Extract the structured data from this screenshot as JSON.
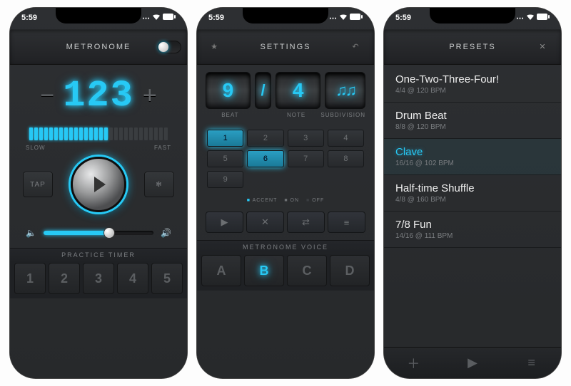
{
  "status": {
    "time": "5:59",
    "signal": "....",
    "wifi": "✓",
    "battery": "■"
  },
  "screen1": {
    "header": {
      "title": "METRONOME"
    },
    "bpm": {
      "value": "123",
      "minus": "−",
      "plus": "+"
    },
    "tempo": {
      "slow_label": "SLOW",
      "fast_label": "FAST",
      "filled_segments": 16,
      "total_segments": 28
    },
    "tap_label": "TAP",
    "volume": {
      "percent": 60
    },
    "practice_label": "PRACTICE TIMER",
    "presets": [
      "1",
      "2",
      "3",
      "4",
      "5"
    ]
  },
  "screen2": {
    "header": {
      "title": "SETTINGS"
    },
    "time_sig": {
      "beat": "9",
      "sep": "/",
      "note": "4",
      "subdivision": "♫♫"
    },
    "ts_labels": {
      "beat": "BEAT",
      "note": "NOTE",
      "sub": "SUBDIVISION"
    },
    "beats": [
      {
        "n": "1",
        "state": "accent"
      },
      {
        "n": "2",
        "state": "norm"
      },
      {
        "n": "3",
        "state": "norm"
      },
      {
        "n": "4",
        "state": "norm"
      },
      {
        "n": "5",
        "state": "norm"
      },
      {
        "n": "6",
        "state": "accent"
      },
      {
        "n": "7",
        "state": "norm"
      },
      {
        "n": "8",
        "state": "norm"
      },
      {
        "n": "9",
        "state": "norm"
      }
    ],
    "legend": {
      "accent": "ACCENT",
      "on": "ON",
      "off": "OFF"
    },
    "voice_label": "METRONOME VOICE",
    "voices": [
      "A",
      "B",
      "C",
      "D"
    ],
    "voice_selected": 1
  },
  "screen3": {
    "header": {
      "title": "PRESETS"
    },
    "items": [
      {
        "title": "One-Two-Three-Four!",
        "sub": "4/4 @ 120 BPM",
        "sel": false
      },
      {
        "title": "Drum Beat",
        "sub": "8/8 @ 120 BPM",
        "sel": false
      },
      {
        "title": "Clave",
        "sub": "16/16 @ 102 BPM",
        "sel": true
      },
      {
        "title": "Half-time Shuffle",
        "sub": "4/8 @ 160 BPM",
        "sel": false
      },
      {
        "title": "7/8 Fun",
        "sub": "14/16 @ 111 BPM",
        "sel": false
      }
    ]
  }
}
